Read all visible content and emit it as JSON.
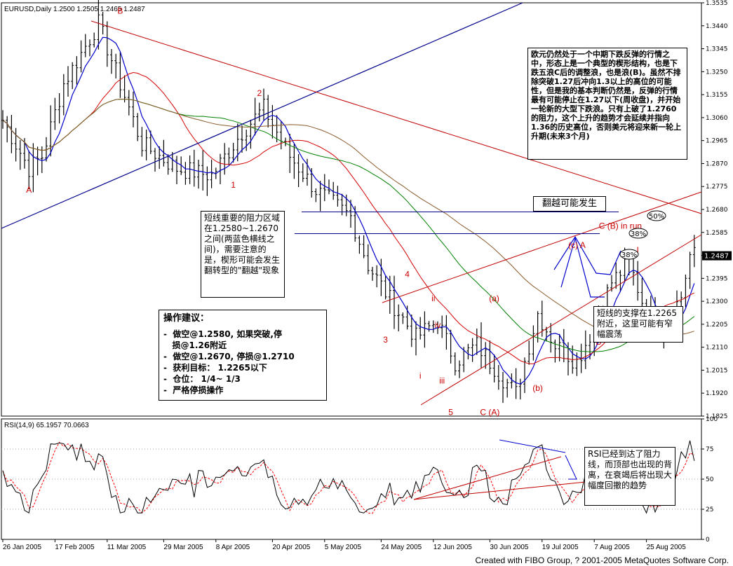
{
  "main_header": "EURUSD,Daily  1.2500 1.2505 1.2465 1.2487",
  "rsi_header": "RSI(14,9) 65.1957 70.0663",
  "credit": "Created with FIBO Group, ? 2001-2005 MetaQuotes Software Corp.",
  "colors": {
    "candle": "#000000",
    "ma_fast": "#0000cc",
    "ma_red": "#d40000",
    "ma_green": "#008000",
    "ma_brown": "#8b5a2b",
    "trend_blue": "#00008b",
    "trend_red": "#c00000",
    "resistance": "#00008b",
    "wave_label": "#cc0000",
    "rsi_line": "#000000",
    "rsi_signal": "#ff0000"
  },
  "annotations": {
    "box_top": "欧元仍然处于一个中期下跌反弹的行情之中，形态上是一个典型的楔形结构，也是下跌五浪C后的调整浪，也是浪(B)。虽然不排除突破1.27后冲向1.3以上的高位的可能性，但是我的基本判断仍然是，反弹的行情最有可能停止在1.27以下(周收盘)，并开始一轮新的大型下跌浪。只有上破了1.2760的阻力，这个上升的趋势才会延续并指向1.36的历史高位，否则美元将迎来新一轮上升期(未来3个月)",
    "box_resist": "短线重要的阻力区域在1.2580~1.2670之间(两蓝色横线之间)，需要注意的是，楔形可能会发生翻转型的\"翻越\"现象",
    "box_advice": {
      "title": "操作建议：",
      "lines": [
        "-  做空@1.2580, 如果突破,停",
        "   损@1.26附近",
        "-  做空@1.2670, 停损@1.2710",
        "-  获利目标： 1.2265以下",
        "-  仓位： 1/4~ 1/3",
        "-  严格停损操作"
      ]
    },
    "box_flip": "翻越可能发生",
    "box_support": "短线的支撑在1.2265附近，这里可能有窄幅震荡",
    "box_rsi": "RSI已经到达了阻力线，而顶部也出现的背离，在衰竭后将出现大幅度回撤的趋势"
  },
  "chart_data": [
    {
      "type": "candlestick",
      "title": "EURUSD,Daily  1.2500 1.2505 1.2465 1.2487",
      "ylim": [
        1.1825,
        1.3535
      ],
      "y_ticks": [
        "1.3535",
        "1.3440",
        "1.3345",
        "1.3250",
        "1.3155",
        "1.3060",
        "1.2965",
        "1.2870",
        "1.2775",
        "1.2680",
        "1.2585",
        "1.2490",
        "1.2395",
        "1.2300",
        "1.2205",
        "1.2110",
        "1.2015",
        "1.1920",
        "1.1825"
      ],
      "current_price": "1.2487",
      "x_ticks": [
        "26 Jan 2005",
        "17 Feb 2005",
        "11 Mar 2005",
        "29 Mar 2005",
        "8 Apr 2005",
        "20 Apr 2005",
        "5 May 2005",
        "24 May 2005",
        "12 Jun 2005",
        "30 Jun 2005",
        "19 Jul 2005",
        "7 Aug 2005",
        "25 Aug 2005"
      ],
      "anchors": [
        {
          "bar": 0,
          "price": 1.305
        },
        {
          "bar": 6,
          "price": 1.285
        },
        {
          "bar": 9,
          "price": 1.29
        },
        {
          "bar": 14,
          "price": 1.32
        },
        {
          "bar": 22,
          "price": 1.345
        },
        {
          "bar": 27,
          "price": 1.32
        },
        {
          "bar": 32,
          "price": 1.295
        },
        {
          "bar": 40,
          "price": 1.285
        },
        {
          "bar": 48,
          "price": 1.282
        },
        {
          "bar": 55,
          "price": 1.3
        },
        {
          "bar": 60,
          "price": 1.31
        },
        {
          "bar": 66,
          "price": 1.29
        },
        {
          "bar": 72,
          "price": 1.276
        },
        {
          "bar": 80,
          "price": 1.265
        },
        {
          "bar": 84,
          "price": 1.245
        },
        {
          "bar": 90,
          "price": 1.228
        },
        {
          "bar": 95,
          "price": 1.215
        },
        {
          "bar": 100,
          "price": 1.222
        },
        {
          "bar": 104,
          "price": 1.205
        },
        {
          "bar": 109,
          "price": 1.212
        },
        {
          "bar": 115,
          "price": 1.198
        },
        {
          "bar": 118,
          "price": 1.192
        },
        {
          "bar": 123,
          "price": 1.225
        },
        {
          "bar": 127,
          "price": 1.212
        },
        {
          "bar": 132,
          "price": 1.205
        },
        {
          "bar": 136,
          "price": 1.22
        },
        {
          "bar": 140,
          "price": 1.238
        },
        {
          "bar": 144,
          "price": 1.246
        },
        {
          "bar": 148,
          "price": 1.225
        },
        {
          "bar": 152,
          "price": 1.22
        },
        {
          "bar": 156,
          "price": 1.232
        },
        {
          "bar": 158,
          "price": 1.249
        }
      ],
      "wave_labels": [
        {
          "text": "A",
          "bar": 6,
          "price": 1.275
        },
        {
          "text": "B",
          "bar": 27,
          "price": 1.349
        },
        {
          "text": "1",
          "bar": 53,
          "price": 1.277
        },
        {
          "text": "2",
          "bar": 59,
          "price": 1.315
        },
        {
          "text": "3",
          "bar": 88,
          "price": 1.213
        },
        {
          "text": "4",
          "bar": 93,
          "price": 1.24
        },
        {
          "text": "5",
          "bar": 103,
          "price": 1.183
        },
        {
          "text": "ii",
          "bar": 99,
          "price": 1.23
        },
        {
          "text": "iv",
          "bar": 100,
          "price": 1.219
        },
        {
          "text": "i",
          "bar": 96,
          "price": 1.198
        },
        {
          "text": "iii",
          "bar": 101,
          "price": 1.196
        },
        {
          "text": "C (A)",
          "bar": 112,
          "price": 1.183
        },
        {
          "text": "(a)",
          "bar": 113,
          "price": 1.23
        },
        {
          "text": "(b)",
          "bar": 123,
          "price": 1.193
        },
        {
          "text": "(c) A",
          "bar": 132,
          "price": 1.252
        },
        {
          "text": "B",
          "bar": 137,
          "price": 1.212
        },
        {
          "text": "C (B) in run",
          "bar": 142,
          "price": 1.26
        },
        {
          "text": "I",
          "bar": 146,
          "price": 1.25
        }
      ],
      "fib_labels": [
        "50%",
        "38%",
        "38%"
      ],
      "resistance_levels": [
        1.267,
        1.258
      ]
    },
    {
      "type": "line",
      "title": "RSI(14,9) 65.1957 70.0663",
      "ylim": [
        0,
        100
      ],
      "y_ticks": [
        "100",
        "75",
        "50",
        "25",
        "0"
      ],
      "series": [
        {
          "name": "RSI",
          "last": 65.1957
        },
        {
          "name": "Signal",
          "last": 70.0663
        }
      ]
    }
  ]
}
